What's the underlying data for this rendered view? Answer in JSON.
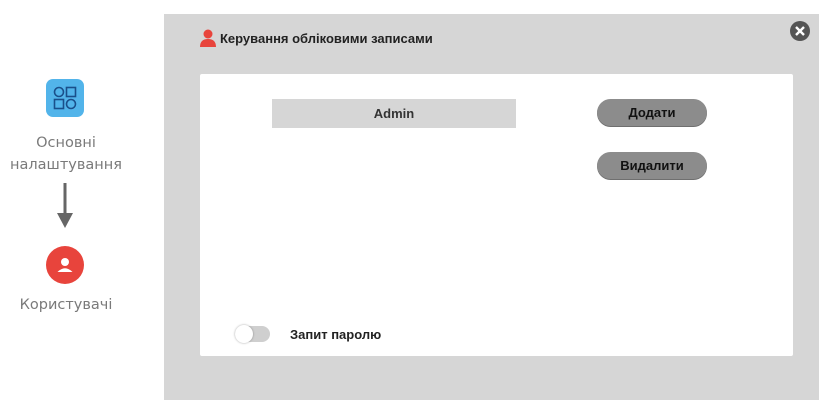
{
  "guide": {
    "step1_label_line1": "Основні",
    "step1_label_line2": "налаштування",
    "step1_icon": "settings-grid-icon",
    "step2_label": "Користувачі",
    "step2_icon": "user-icon"
  },
  "dialog": {
    "title": "Керування обліковими записами",
    "title_icon": "user-icon",
    "close_icon": "close-icon",
    "accounts": [
      "Admin"
    ],
    "add_label": "Додати",
    "delete_label": "Видалити",
    "password_request_label": "Запит паролю",
    "password_request_enabled": false
  },
  "colors": {
    "accent_red": "#e8443c",
    "settings_blue": "#52b4ea",
    "dialog_bg": "#d6d6d6",
    "button_bg": "#8c8c8c"
  }
}
